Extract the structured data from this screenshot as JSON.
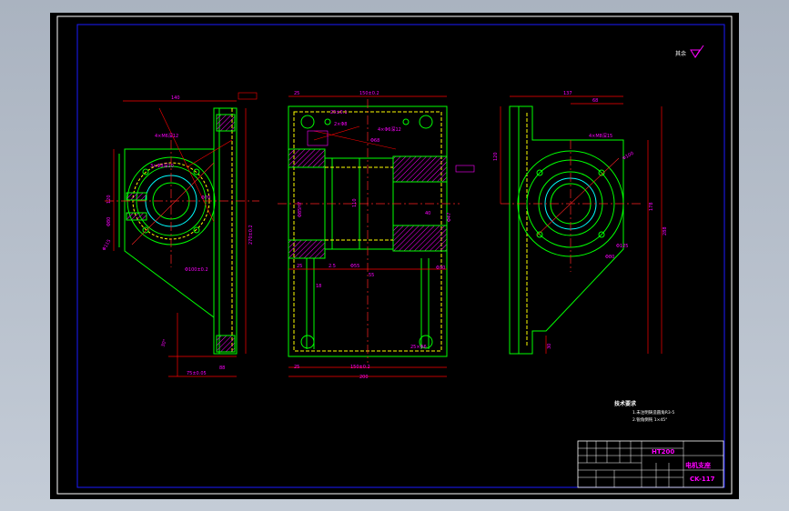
{
  "title_block": {
    "material": "HT200",
    "part_name": "电机支座",
    "drawing_no": "CK-117"
  },
  "technical_requirements": {
    "heading": "技术要求",
    "items": [
      "1.未注明铸造圆角R3-5",
      "2.锐角倒钝 1×45°"
    ]
  },
  "roughness_note": "其余",
  "dimensions": {
    "left_view": [
      "140",
      "120",
      "4×M6深12",
      "3×Φ8深10",
      "Φ100±0.2",
      "Φ70",
      "Φ80",
      "Φ115",
      "75±0.05",
      "88",
      "270±0.2",
      "30°"
    ],
    "front_view": [
      "25",
      "150±0.2",
      "25±0.1",
      "2×Φ8",
      "4×Φ6深12",
      "Φ68",
      "110",
      "40",
      "Φ85H7",
      "Φ47",
      "Φ55",
      "25",
      "2.5",
      "55",
      "Φ30",
      "18",
      "25×Φ6",
      "150±0.2",
      "200",
      "25"
    ],
    "right_view": [
      "137",
      "68",
      "4×M8深15",
      "120",
      "178",
      "Φ125",
      "Φ80",
      "Φ100",
      "288",
      "30"
    ]
  },
  "colors": {
    "background": "#000000",
    "outline": "#00ff00",
    "hidden": "#ffff00",
    "dimension": "#ff0000",
    "text": "#ff00ff",
    "center": "#ff2222",
    "border": "#ffffff",
    "inner_frame": "#1a1aff",
    "hatch": "#ff00ff",
    "arc": "#00ffff"
  }
}
